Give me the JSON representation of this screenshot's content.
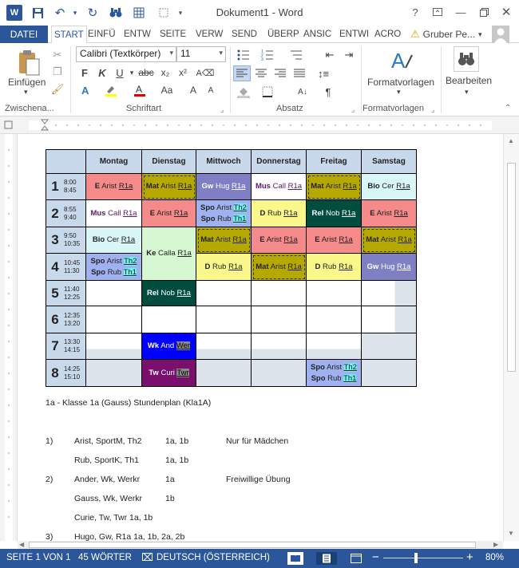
{
  "titlebar": {
    "doc_title": "Dokument1 - Word",
    "help": "?",
    "icons": [
      "word-logo",
      "save-icon",
      "undo-icon",
      "redo-icon",
      "binoculars-icon",
      "table-icon",
      "layout-icon"
    ]
  },
  "tabs": {
    "file": "DATEI",
    "items": [
      "START",
      "EINFÜ",
      "ENTW",
      "SEITE",
      "VERW",
      "SEND",
      "ÜBERP",
      "ANSIC",
      "ENTWI",
      "ACRO"
    ],
    "user": "Gruber Pe..."
  },
  "ribbon": {
    "paste_label": "Einfügen",
    "clipboard_label": "Zwischena...",
    "font_name": "Calibri (Textkörper)",
    "font_size": "11",
    "bold": "F",
    "italic": "K",
    "underline": "U",
    "font_group_label": "Schriftart",
    "paragraph_group_label": "Absatz",
    "styles_button": "Formatvorlagen",
    "styles_group_label": "Formatvorlagen",
    "edit_button": "Bearbeiten"
  },
  "timetable": {
    "days": [
      "Montag",
      "Dienstag",
      "Mittwoch",
      "Donnerstag",
      "Freitag",
      "Samstag"
    ],
    "periods": [
      {
        "num": "1",
        "start": "8:00",
        "end": "8:45"
      },
      {
        "num": "2",
        "start": "8:55",
        "end": "9:40"
      },
      {
        "num": "3",
        "start": "9:50",
        "end": "10:35"
      },
      {
        "num": "4",
        "start": "10:45",
        "end": "11:30"
      },
      {
        "num": "5",
        "start": "11:40",
        "end": "12:25"
      },
      {
        "num": "6",
        "start": "12:35",
        "end": "13:20"
      },
      {
        "num": "7",
        "start": "13:30",
        "end": "14:15"
      },
      {
        "num": "8",
        "start": "14:25",
        "end": "15:10"
      }
    ],
    "cells": {
      "p1_mo": [
        "E",
        "Arist",
        "R1a"
      ],
      "p1_di": [
        "Mat",
        "Arist",
        "R1a"
      ],
      "p1_mi": [
        "Gw",
        "Hug",
        "R1a"
      ],
      "p1_do": [
        "Mus",
        "Call",
        "R1a"
      ],
      "p1_fr": [
        "Mat",
        "Arist",
        "R1a"
      ],
      "p1_sa": [
        "Bio",
        "Cer",
        "R1a"
      ],
      "p2_mo": [
        "Mus",
        "Call",
        "R1a"
      ],
      "p2_di": [
        "E",
        "Arist",
        "R1a"
      ],
      "p2_mi_a": [
        "Spo",
        "Arist",
        "Th2"
      ],
      "p2_mi_b": [
        "Spo",
        "Rub",
        "Th1"
      ],
      "p2_do": [
        "D",
        "Rub",
        "R1a"
      ],
      "p2_fr": [
        "Rel",
        "Nob",
        "R1a"
      ],
      "p2_sa": [
        "E",
        "Arist",
        "R1a"
      ],
      "p3_mo": [
        "Bio",
        "Cer",
        "R1a"
      ],
      "p34_di": [
        "Ke",
        "Calla",
        "R1a"
      ],
      "p3_mi": [
        "Mat",
        "Arist",
        "R1a"
      ],
      "p3_do": [
        "E",
        "Arist",
        "R1a"
      ],
      "p3_fr": [
        "E",
        "Arist",
        "R1a"
      ],
      "p3_sa": [
        "Mat",
        "Arist",
        "R1a"
      ],
      "p4_mo_a": [
        "Spo",
        "Arist",
        "Th2"
      ],
      "p4_mo_b": [
        "Spo",
        "Rub",
        "Th1"
      ],
      "p4_mi": [
        "D",
        "Rub",
        "R1a"
      ],
      "p4_do": [
        "Mat",
        "Arist",
        "R1a"
      ],
      "p4_fr": [
        "D",
        "Rub",
        "R1a"
      ],
      "p4_sa": [
        "Gw",
        "Hug",
        "R1a"
      ],
      "p5_di": [
        "Rel",
        "Nob",
        "R1a"
      ],
      "p7_di": [
        "Wk",
        "And",
        "Wer"
      ],
      "p8_di": [
        "Tw",
        "Curi",
        "Twr"
      ],
      "p8_fr_a": [
        "Spo",
        "Arist",
        "Th2"
      ],
      "p8_fr_b": [
        "Spo",
        "Rub",
        "Th1"
      ]
    },
    "caption": "1a - Klasse 1a (Gauss) Stundenplan  (Kla1A)"
  },
  "notes": [
    {
      "num": "1)",
      "teachers": "Arist, SportM,  Th2",
      "classes": "1a, 1b",
      "comment": "Nur für Mädchen"
    },
    {
      "num": "",
      "teachers": "Rub, SportK,  Th1",
      "classes": "1a, 1b",
      "comment": ""
    },
    {
      "num": "2)",
      "teachers": "Ander, Wk,  Werkr",
      "classes": "1a",
      "comment": "Freiwillige Übung"
    },
    {
      "num": "",
      "teachers": "Gauss, Wk,  Werkr",
      "classes": "1b",
      "comment": ""
    },
    {
      "num": "",
      "teachers": "Curie, Tw,  Twr 1a, 1b",
      "classes": "",
      "comment": ""
    },
    {
      "num": "3)",
      "teachers": "Hugo, Gw,  R1a 1a, 1b, 2a, 2b",
      "classes": "",
      "comment": ""
    }
  ],
  "status": {
    "page": "SEITE 1 VON 1",
    "words": "45 WÖRTER",
    "language": "DEUTSCH (ÖSTERREICH)",
    "zoom": "80%"
  },
  "colors": {
    "accent": "#2b579a",
    "header_bg": "#c9d9ec",
    "english": "#f48a8a",
    "math": "#b5a900",
    "geo": "#7f7fc4",
    "music": "#ffffff",
    "biology": "#d9f6f6",
    "sport": "#9fb2ef",
    "german": "#fbf88b",
    "religion": "#004d40",
    "ethics": "#d7f7d2",
    "werken": "#0000ff",
    "textil": "#7a0f6d"
  }
}
